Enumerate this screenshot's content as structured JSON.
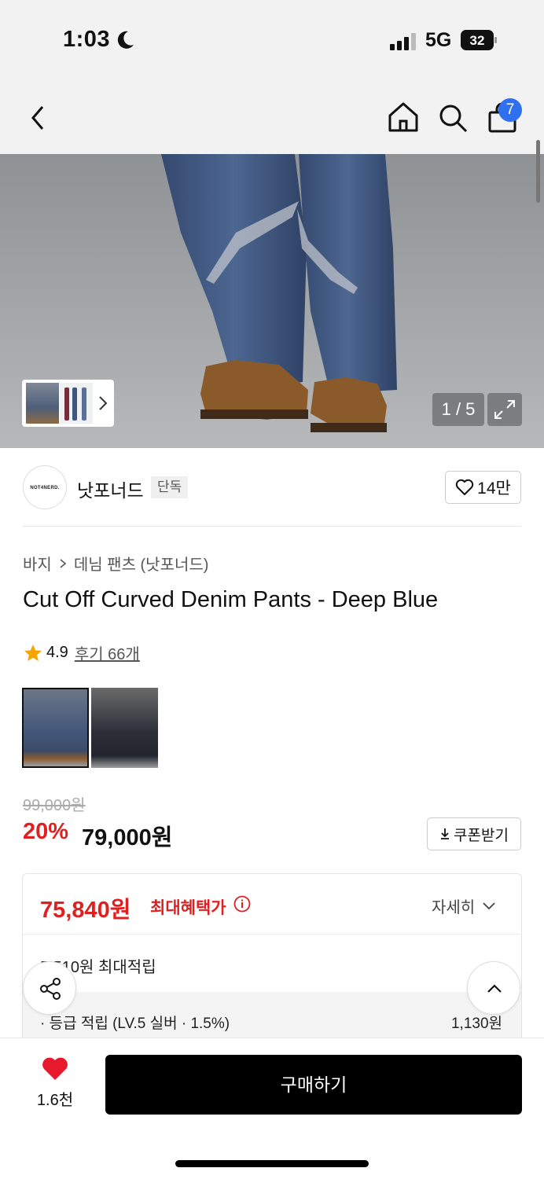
{
  "status_bar": {
    "time": "1:03",
    "network": "5G",
    "battery": "32"
  },
  "header": {
    "cart_count": "7",
    "icons": [
      "back-icon",
      "home-icon",
      "search-icon",
      "shopping-bag-icon"
    ]
  },
  "gallery": {
    "counter": "1 / 5"
  },
  "brand": {
    "logo_text": "NOT4NERD.",
    "name": "낫포너드",
    "tag": "단독",
    "likes": "14만"
  },
  "breadcrumb": {
    "category": "바지",
    "subcategory": "데님 팬츠 (낫포너드)"
  },
  "product": {
    "title": "Cut Off Curved Denim Pants - Deep Blue",
    "rating": "4.9",
    "reviews": "후기 66개",
    "original_price": "99,000원",
    "discount_rate": "20%",
    "sale_price": "79,000원",
    "coupon_label": "쿠폰받기"
  },
  "benefit": {
    "best_price": "75,840원",
    "best_label": "최대혜택가",
    "detail_label": "자세히",
    "points_line": "5,510원 최대적립",
    "level_line": "· 등급 적립 (LV.5 실버 · 1.5%)",
    "level_amount": "1,130원"
  },
  "bottom_bar": {
    "wish_count": "1.6천",
    "buy_label": "구매하기"
  },
  "colors": {
    "accent_red": "#e02020",
    "badge_blue": "#2f6ff0",
    "star": "#f5a400"
  }
}
